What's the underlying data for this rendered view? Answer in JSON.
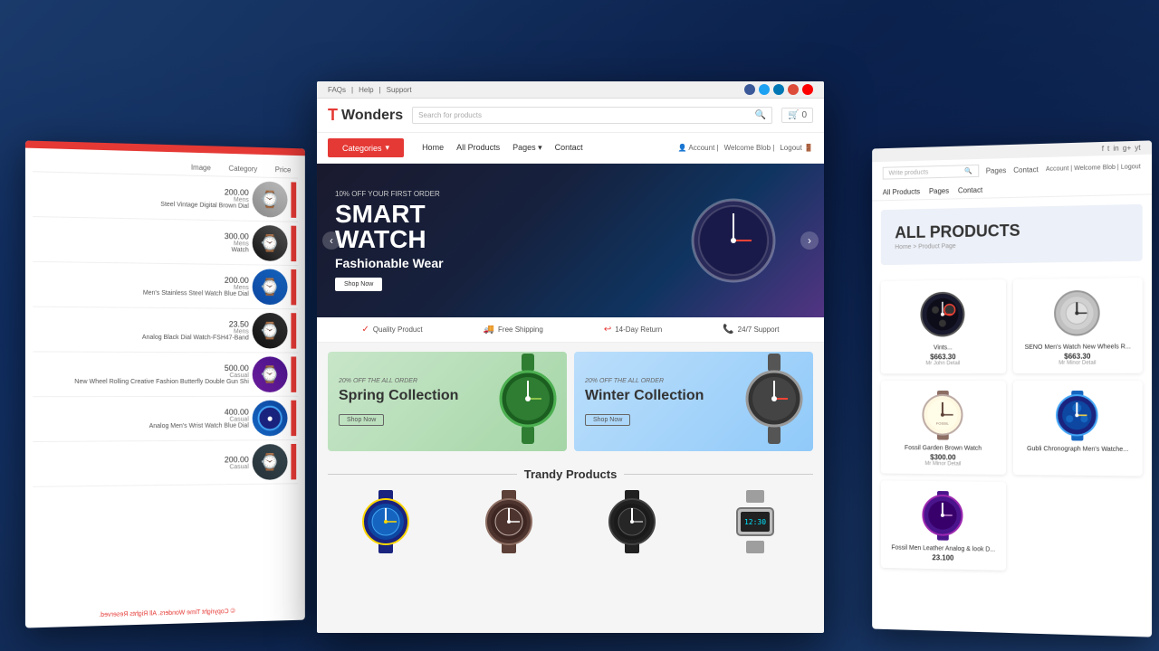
{
  "background": {
    "color": "#1a3a6b"
  },
  "top_bar": {
    "links": [
      "FAQs",
      "Help",
      "Support"
    ],
    "social_icons": [
      "f",
      "t",
      "in",
      "g+",
      "yt"
    ]
  },
  "navbar": {
    "brand_letter": "T",
    "brand_name": "Wonders",
    "search_placeholder": "Search for products",
    "cart_label": "0"
  },
  "categories_nav": {
    "categories_label": "Categories",
    "nav_links": [
      "Home",
      "All Products",
      "Pages",
      "Contact"
    ],
    "account_label": "Account",
    "welcome_label": "Welcome Blob",
    "logout_label": "Logout"
  },
  "hero": {
    "discount_text": "10% OFF YOUR FIRST ORDER",
    "title_line1": "SMART",
    "title_line2": "WATCH",
    "subtitle": "Fashionable Wear",
    "cta_label": "Shop Now"
  },
  "features": [
    {
      "icon": "✓",
      "label": "Quality Product"
    },
    {
      "icon": "🚚",
      "label": "Free Shipping"
    },
    {
      "icon": "↩",
      "label": "14-Day Return"
    },
    {
      "icon": "📞",
      "label": "24/7 Support"
    }
  ],
  "collections": [
    {
      "id": "spring",
      "offer": "20% OFF THE ALL ORDER",
      "title": "Spring Collection",
      "cta": "Shop Now"
    },
    {
      "id": "winter",
      "offer": "20% OFF THE ALL ORDER",
      "title": "Winter Collection",
      "cta": "Shop Now"
    }
  ],
  "trendy": {
    "section_title": "Trandy Products",
    "products": [
      {
        "emoji": "🕐",
        "color": "#1a237e"
      },
      {
        "emoji": "🕐",
        "color": "#4e342e"
      },
      {
        "emoji": "🕐",
        "color": "#37474f"
      },
      {
        "emoji": "🕐",
        "color": "#78909c"
      }
    ]
  },
  "left_panel": {
    "column_headers": [
      "Image",
      "Category",
      "Price"
    ],
    "rows": [
      {
        "emoji": "⌚",
        "name": "Steel Vintage Digital Brown Dial",
        "category": "Mens",
        "price": "200.00"
      },
      {
        "emoji": "⌚",
        "name": "Watch",
        "category": "Mens",
        "price": "300.00"
      },
      {
        "emoji": "⌚",
        "name": "Men's Stainless Steel Watch Blue Dial",
        "category": "Mens",
        "price": "200.00"
      },
      {
        "emoji": "⌚",
        "name": "Analog Black Dial Watch-FSH47-Band",
        "category": "Mens",
        "price": "23.50"
      },
      {
        "emoji": "⌚",
        "name": "New Wheel Rolling Creative Fashion Butterfly Double Gun Shi",
        "category": "Casual",
        "price": "500.00"
      },
      {
        "emoji": "⌚",
        "name": "Analog Men's Wrist Watch Blue Dial",
        "category": "Casual",
        "price": "400.00"
      },
      {
        "emoji": "⌚",
        "name": "",
        "category": "Casual",
        "price": "200.00"
      }
    ],
    "footer": "© Copyright Time Wonders. All Rights Reserved."
  },
  "right_panel": {
    "social_icons": [
      "f",
      "t",
      "in",
      "g+",
      "yt"
    ],
    "search_placeholder": "Write products",
    "nav_links": [
      "All Products",
      "Pages",
      "Contact"
    ],
    "account_label": "Account",
    "welcome_label": "Welcome Blob",
    "logout_label": "Logout",
    "page_title": "ALL PRODUCTS",
    "breadcrumb": "Home > Product Page",
    "products": [
      {
        "name": "Vints...",
        "emoji": "⌚",
        "color": "#1a1a2e",
        "price": "$663.30",
        "badge": "Mr John Detail"
      },
      {
        "name": "SENO Men's Watch New Wheels R...",
        "emoji": "⌚",
        "color": "#c0c0c0",
        "price": "$663.30",
        "badge": "Mr Minor Detail"
      },
      {
        "name": "Fossil Garden Brown Watch",
        "emoji": "⌚",
        "color": "#8B4513",
        "price": "$300.00",
        "badge": "Mr Minor Detail"
      },
      {
        "name": "Gubli Chronograph Men's Watche...",
        "emoji": "⌚",
        "color": "#1565c0",
        "price": "",
        "badge": ""
      },
      {
        "name": "Fossil Men Leather Analog & look D...",
        "emoji": "⌚",
        "color": "#4a148c",
        "price": "23.100",
        "badge": ""
      }
    ]
  }
}
